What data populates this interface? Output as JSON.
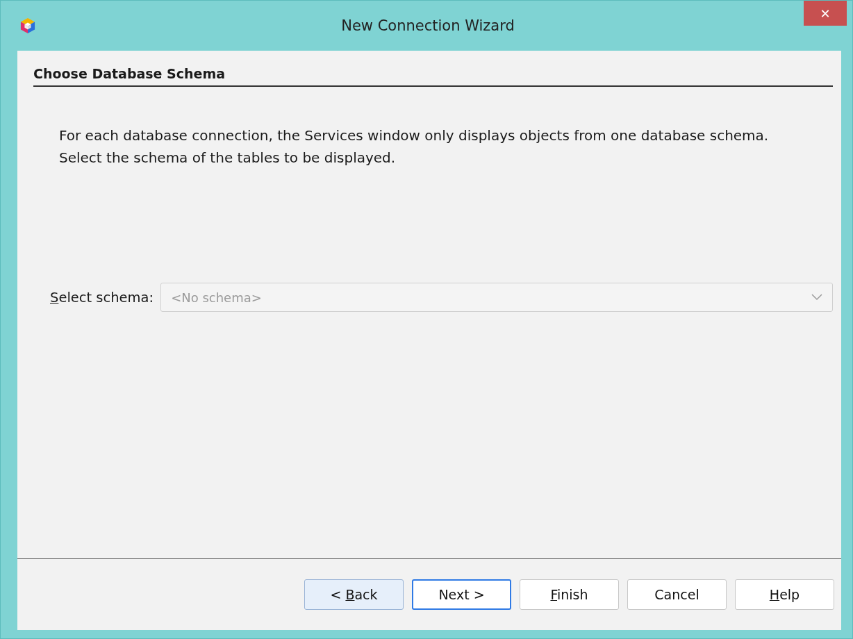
{
  "window": {
    "title": "New Connection Wizard",
    "close_label": "✕"
  },
  "page": {
    "heading": "Choose Database Schema",
    "description": [
      "For each database connection, the Services window only displays objects from one database schema.",
      "Select the schema of the tables to be displayed."
    ]
  },
  "schema_select": {
    "label": {
      "key": "S",
      "after": "elect schema:"
    },
    "value": "<No schema>",
    "disabled": true
  },
  "buttons": [
    {
      "label": {
        "before": "< ",
        "key": "B",
        "after": "ack"
      },
      "hovered": true,
      "focused": false
    },
    {
      "label": {
        "before": "Next >"
      },
      "hovered": false,
      "focused": true
    },
    {
      "label": {
        "key": "F",
        "after": "inish"
      },
      "hovered": false,
      "focused": false
    },
    {
      "label": {
        "before": "Cancel"
      },
      "hovered": false,
      "focused": false
    },
    {
      "label": {
        "key": "H",
        "after": "elp"
      },
      "hovered": false,
      "focused": false
    }
  ]
}
